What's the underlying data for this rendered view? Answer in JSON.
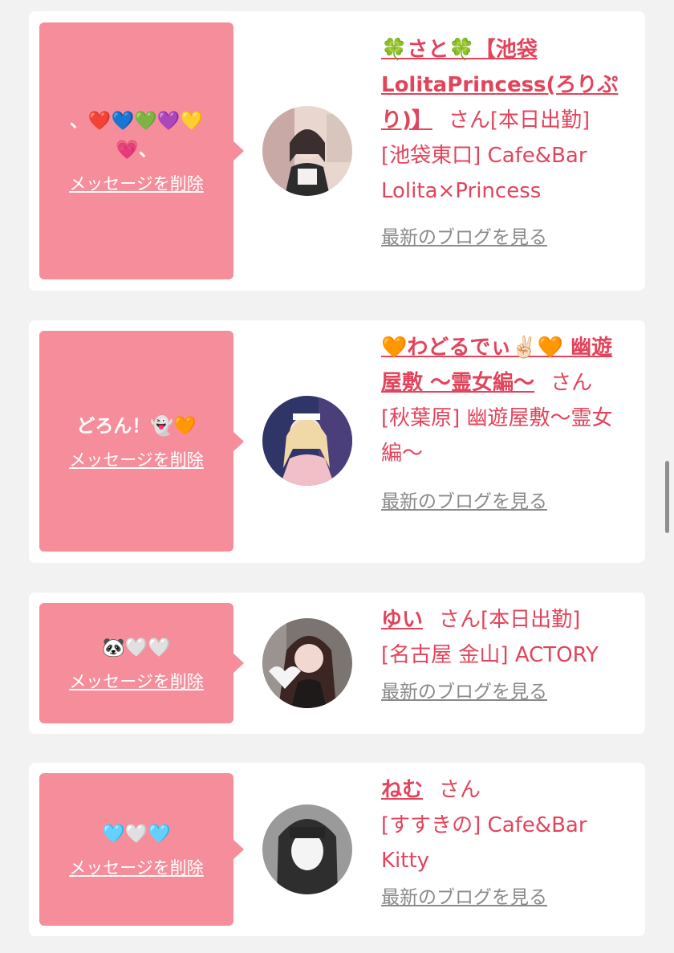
{
  "cards": [
    {
      "message": "、❤️💙💚💜💛💗、",
      "delete_label": "メッセージを削除",
      "name": "🍀さと🍀【池袋LolitaPrincess(ろりぷり)】",
      "suffix": "さん[本日出勤]",
      "shop": "[池袋東口] Cafe&Bar Lolita×Princess",
      "blog_label": "最新のブログを見る",
      "avatar_colors": [
        "#e9c9c2",
        "#5a4a4a"
      ]
    },
    {
      "message": "どろん！👻🧡",
      "delete_label": "メッセージを削除",
      "name": "🧡わどるでぃ✌🏻🧡 幽遊屋敷 〜霊女編〜",
      "suffix": "さん",
      "shop": "[秋葉原] 幽遊屋敷〜霊女編〜",
      "blog_label": "最新のブログを見る",
      "avatar_colors": [
        "#3a3c6e",
        "#f2c6cf"
      ]
    },
    {
      "message": "🐼🤍🤍",
      "delete_label": "メッセージを削除",
      "name": "ゆい",
      "suffix": "さん[本日出勤]",
      "shop": "[名古屋 金山] ACTORY",
      "blog_label": "最新のブログを見る",
      "avatar_colors": [
        "#6b5a58",
        "#2a2424"
      ]
    },
    {
      "message": "🩵🤍🩵",
      "delete_label": "メッセージを削除",
      "name": "ねむ",
      "suffix": "さん",
      "shop": "[すすきの] Cafe&Bar Kitty",
      "blog_label": "最新のブログを見る",
      "avatar_colors": [
        "#8d8d8d",
        "#2f2f2f"
      ]
    }
  ]
}
